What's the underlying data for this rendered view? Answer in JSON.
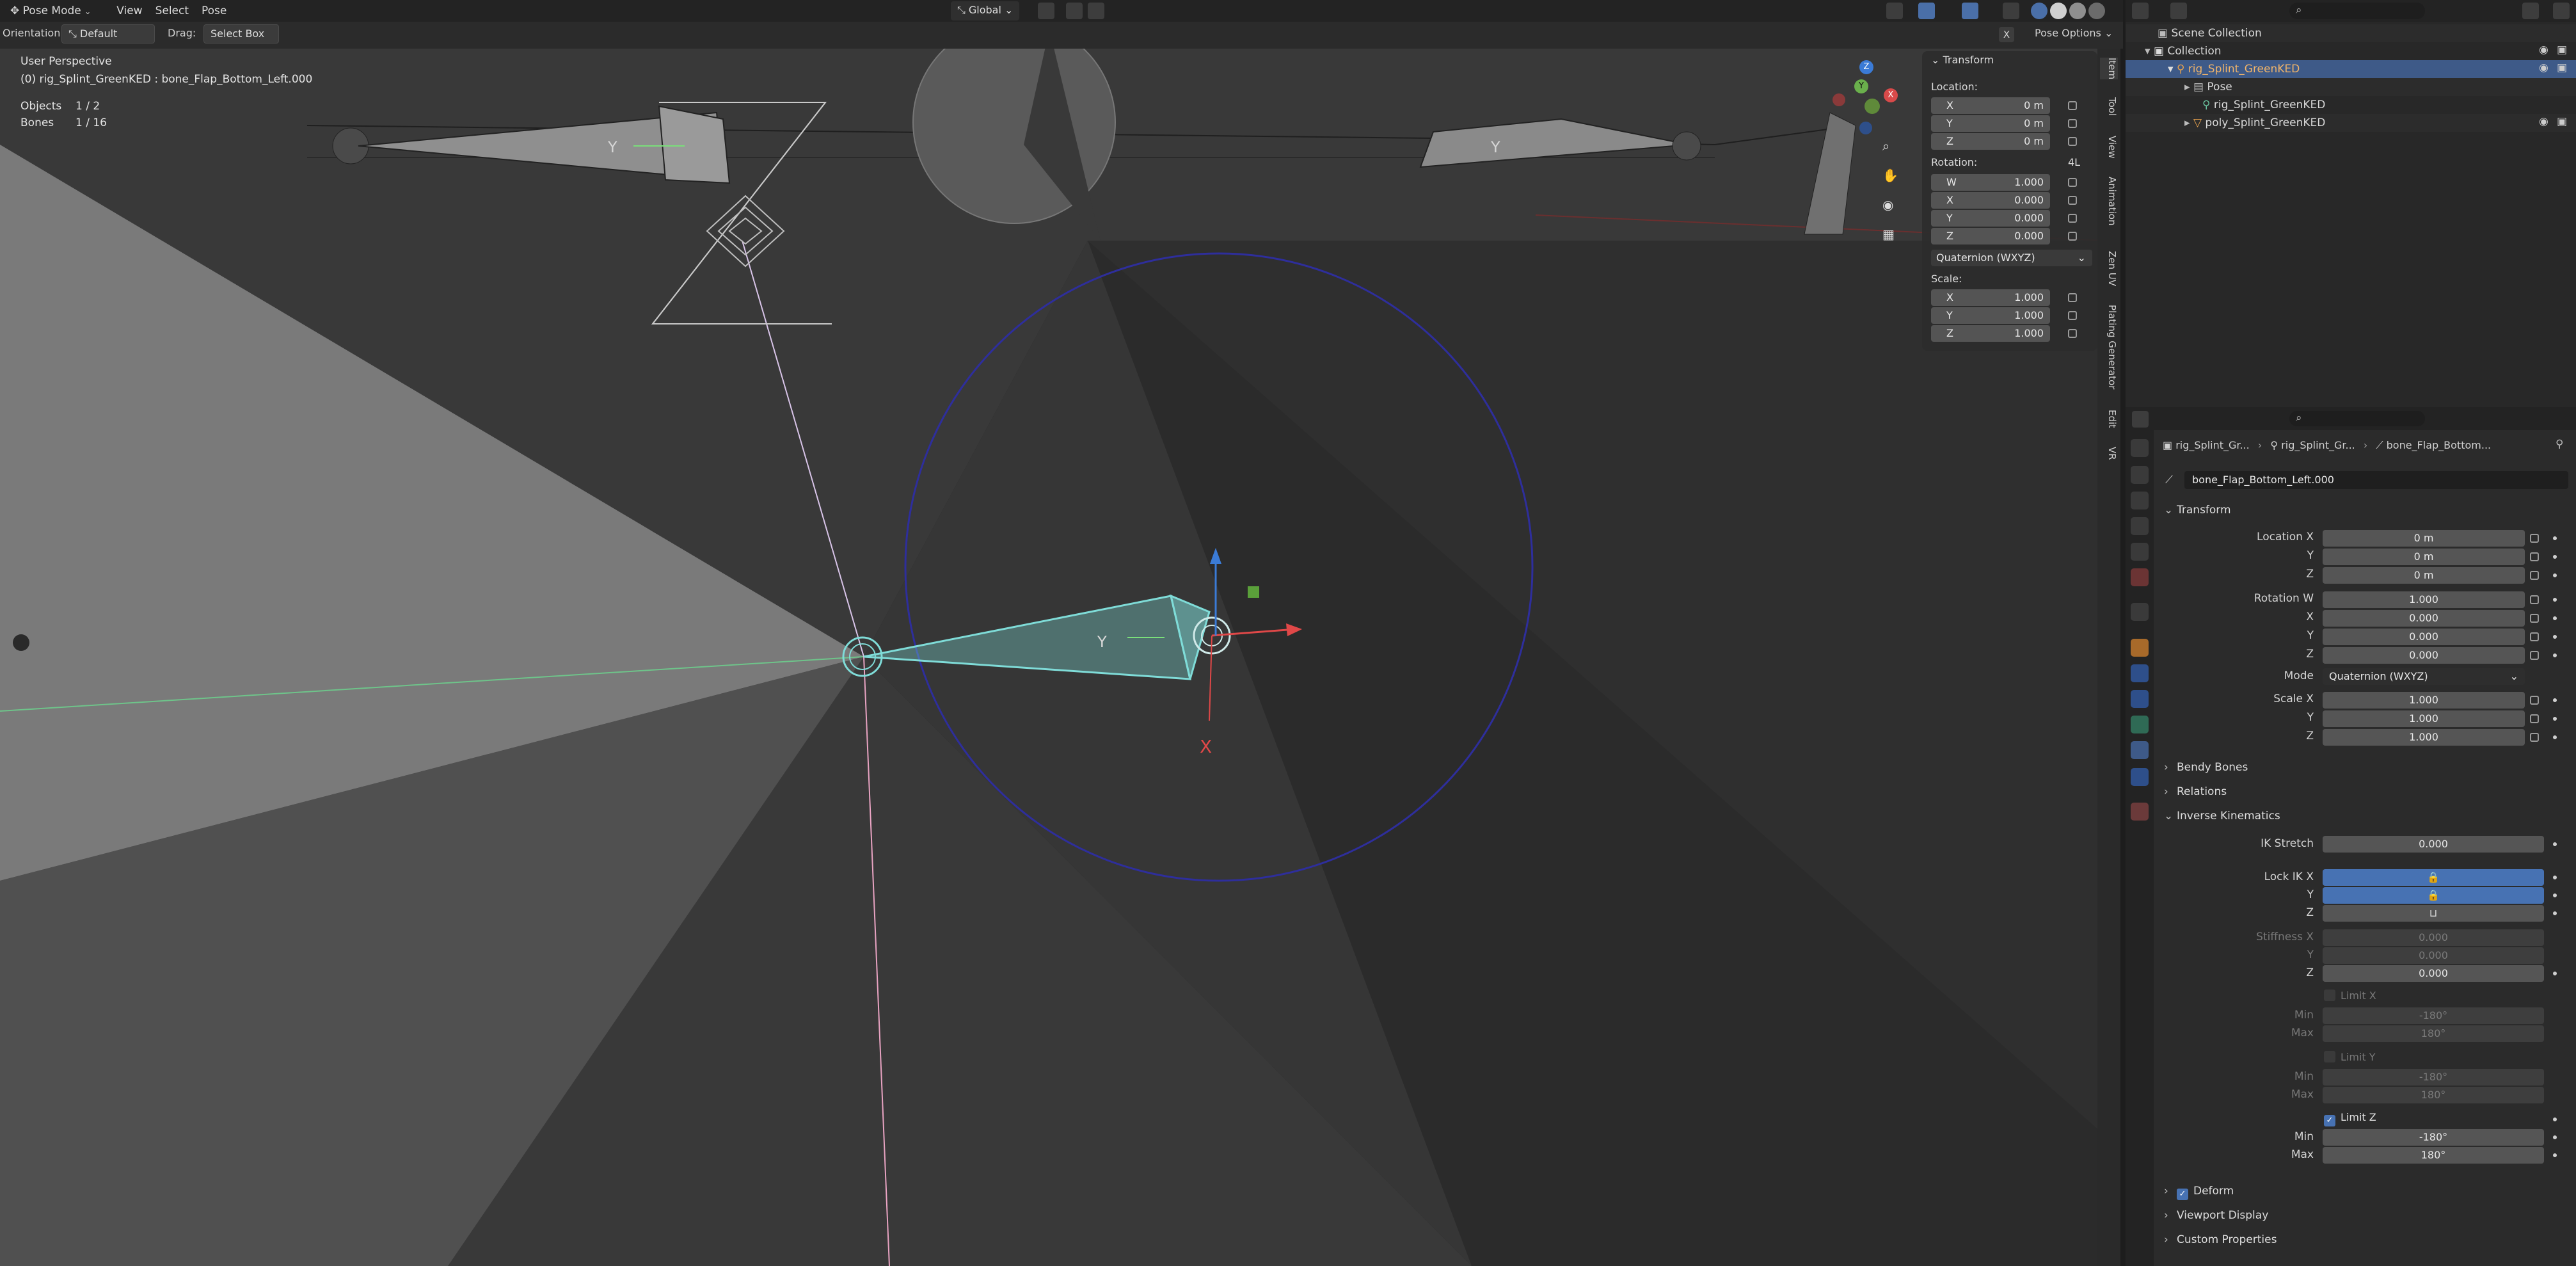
{
  "header": {
    "mode": "Pose Mode",
    "menus": [
      "View",
      "Select",
      "Pose"
    ],
    "transform_orientation": "Global",
    "orientation_label": "Orientation:",
    "orientation_value": "Default",
    "drag_label": "Drag:",
    "drag_value": "Select Box",
    "pose_options": "Pose Options",
    "x_mirror": "X"
  },
  "overlay": {
    "perspective": "User Perspective",
    "active": "(0) rig_Splint_GreenKED : bone_Flap_Bottom_Left.000",
    "objects_label": "Objects",
    "objects_value": "1 / 2",
    "bones_label": "Bones",
    "bones_value": "1 / 16"
  },
  "npanel": {
    "title": "Transform",
    "location_label": "Location:",
    "location": [
      {
        "axis": "X",
        "value": "0 m"
      },
      {
        "axis": "Y",
        "value": "0 m"
      },
      {
        "axis": "Z",
        "value": "0 m"
      }
    ],
    "rotation_label": "Rotation:",
    "rotation_mode_short": "4L",
    "rotation": [
      {
        "axis": "W",
        "value": "1.000"
      },
      {
        "axis": "X",
        "value": "0.000"
      },
      {
        "axis": "Y",
        "value": "0.000"
      },
      {
        "axis": "Z",
        "value": "0.000"
      }
    ],
    "rotation_mode": "Quaternion (WXYZ)",
    "scale_label": "Scale:",
    "scale": [
      {
        "axis": "X",
        "value": "1.000"
      },
      {
        "axis": "Y",
        "value": "1.000"
      },
      {
        "axis": "Z",
        "value": "1.000"
      }
    ]
  },
  "vtabs": [
    "Item",
    "Tool",
    "View",
    "Animation",
    "Zen UV",
    "Plating Generator",
    "Edit",
    "VR"
  ],
  "outliner": {
    "items": [
      "Scene Collection",
      "Collection",
      "rig_Splint_GreenKED",
      "Pose",
      "rig_Splint_GreenKED",
      "poly_Splint_GreenKED"
    ]
  },
  "props": {
    "breadcrumb": [
      "rig_Splint_Gr...",
      "rig_Splint_Gr...",
      "bone_Flap_Bottom..."
    ],
    "bone_name": "bone_Flap_Bottom_Left.000",
    "transform_title": "Transform",
    "location_x_label": "Location X",
    "location": [
      "0 m",
      "0 m",
      "0 m"
    ],
    "rotation_w_label": "Rotation W",
    "rotation": [
      "1.000",
      "0.000",
      "0.000",
      "0.000"
    ],
    "mode_label": "Mode",
    "mode_value": "Quaternion (WXYZ)",
    "scale_x_label": "Scale X",
    "scale": [
      "1.000",
      "1.000",
      "1.000"
    ],
    "y_label": "Y",
    "z_label": "Z",
    "x_label": "X",
    "bendy_bones": "Bendy Bones",
    "relations": "Relations",
    "ik_title": "Inverse Kinematics",
    "ik_stretch_label": "IK Stretch",
    "ik_stretch": "0.000",
    "lock_ik_label": "Lock IK X",
    "stiffness_label": "Stiffness X",
    "stiffness": [
      "0.000",
      "0.000",
      "0.000"
    ],
    "limit_x": "Limit X",
    "limit_y": "Limit Y",
    "limit_z": "Limit Z",
    "min_label": "Min",
    "max_label": "Max",
    "min_value": "-180°",
    "max_value": "180°",
    "deform": "Deform",
    "viewport_display": "Viewport Display",
    "custom_properties": "Custom Properties"
  },
  "colors": {
    "accent_blue": "#4772b3",
    "selected_bone": "#7fdcd8",
    "rig_orange": "#e8a24d"
  }
}
